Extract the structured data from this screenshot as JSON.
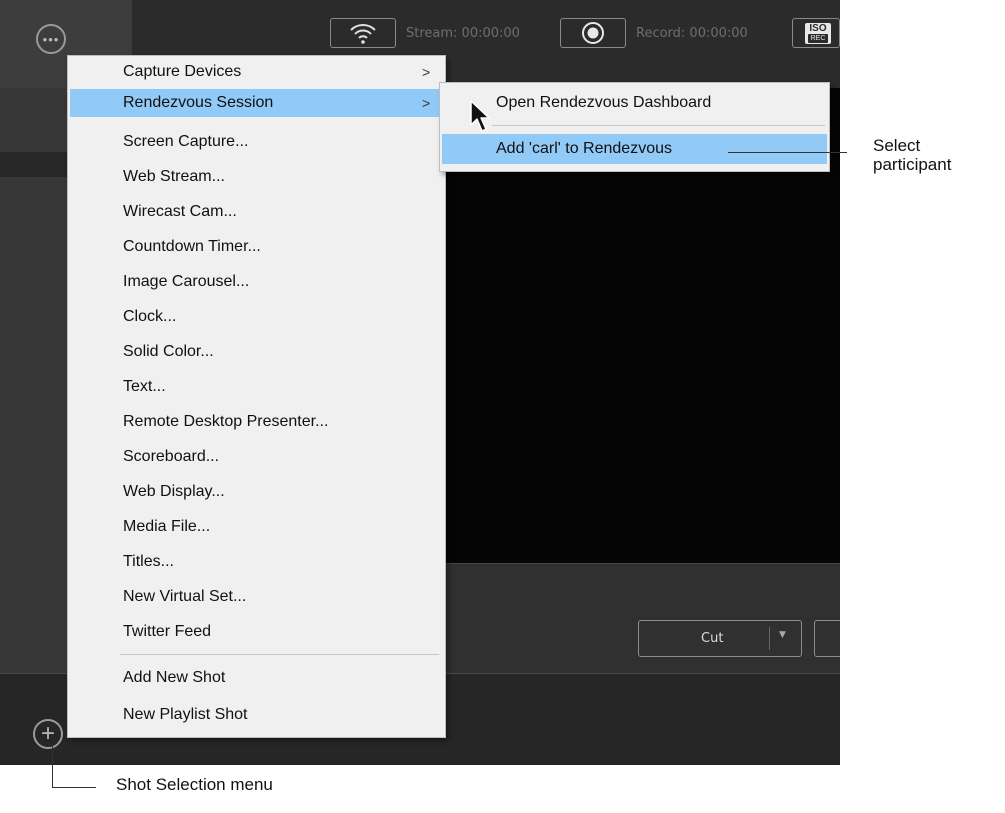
{
  "toolbar": {
    "stream_label": "Stream: 00:00:00",
    "record_label": "Record: 00:00:00",
    "iso_top": "ISO",
    "iso_bottom": "REC"
  },
  "transition": {
    "cut_label": "Cut"
  },
  "main_menu": {
    "items": [
      {
        "label": "Capture Devices",
        "has_submenu": true
      },
      {
        "label": "Rendezvous Session",
        "has_submenu": true,
        "highlighted": true
      },
      {
        "label": "Screen Capture..."
      },
      {
        "label": "Web Stream..."
      },
      {
        "label": "Wirecast Cam..."
      },
      {
        "label": "Countdown Timer..."
      },
      {
        "label": "Image Carousel..."
      },
      {
        "label": "Clock..."
      },
      {
        "label": "Solid Color..."
      },
      {
        "label": "Text..."
      },
      {
        "label": "Remote Desktop Presenter..."
      },
      {
        "label": "Scoreboard..."
      },
      {
        "label": "Web Display..."
      },
      {
        "label": "Media File..."
      },
      {
        "label": "Titles..."
      },
      {
        "label": "New Virtual Set..."
      },
      {
        "label": "Twitter Feed"
      },
      {
        "label": "Add New Shot"
      },
      {
        "label": "New Playlist Shot"
      }
    ],
    "submenu_arrow": ">"
  },
  "sub_menu": {
    "items": [
      {
        "label": "Open Rendezvous Dashboard"
      },
      {
        "label": "Add 'carl' to Rendezvous",
        "highlighted": true
      }
    ]
  },
  "annotations": {
    "select_participant_line1": "Select",
    "select_participant_line2": "participant",
    "shot_selection_menu": "Shot Selection menu"
  },
  "icons": {
    "more": "more-options-icon",
    "add": "add-shot-icon",
    "stream": "wifi-broadcast-icon",
    "record": "record-icon",
    "iso": "iso-rec-icon"
  },
  "colors": {
    "menu_highlight": "#91c9f7",
    "menu_background": "#f0f0f0",
    "app_background": "#2d2d2d"
  }
}
